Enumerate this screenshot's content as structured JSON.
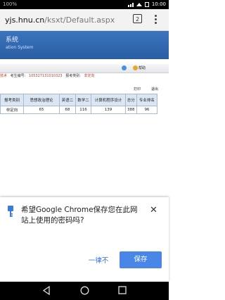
{
  "status_bar": {
    "left_text": "100%",
    "time": "10:00"
  },
  "browser": {
    "url_host": "yjs.hnu.cn",
    "url_path": "/ksxt/Default.aspx",
    "tab_count": "2"
  },
  "site": {
    "title": "系统",
    "subtitle": "ation System",
    "nav_help": "帮助"
  },
  "info": {
    "field_label": "技术",
    "exam_no_label": "考生编号:",
    "exam_no": "105327131010323",
    "category_label": "报考类别:",
    "category": "非定向"
  },
  "actions": {
    "print": "打印",
    "back": "退出"
  },
  "table": {
    "headers": [
      "报考类别",
      "思想政治理论",
      "英语二",
      "数学二",
      "计算机程序设计",
      "总分",
      "专业排名"
    ],
    "rows": [
      [
        "非定向",
        "65",
        "68",
        "116",
        "139",
        "388",
        "96"
      ]
    ]
  },
  "password_dialog": {
    "message": "希望Google Chrome保存您在此网站上使用的密码吗?",
    "never_label": "一律不",
    "save_label": "保存"
  },
  "colors": {
    "banner": "#2a5ea3",
    "accent": "#4a86e8",
    "table_header": "#dbe6f4"
  }
}
